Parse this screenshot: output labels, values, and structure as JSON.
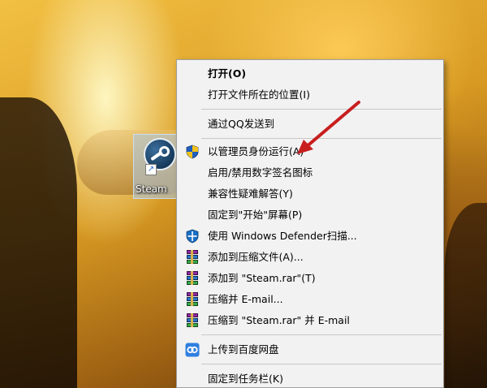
{
  "desktop": {
    "icon_label": "Steam"
  },
  "context_menu": {
    "items": [
      {
        "label": "打开(O)",
        "bold": true
      },
      {
        "label": "打开文件所在的位置(I)"
      },
      {
        "label": "通过QQ发送到"
      },
      {
        "label": "以管理员身份运行(A)",
        "icon": "uac-shield-icon"
      },
      {
        "label": "启用/禁用数字签名图标"
      },
      {
        "label": "兼容性疑难解答(Y)"
      },
      {
        "label": "固定到\"开始\"屏幕(P)"
      },
      {
        "label": "使用 Windows Defender扫描...",
        "icon": "windows-defender-icon"
      },
      {
        "label": "添加到压缩文件(A)...",
        "icon": "winrar-icon"
      },
      {
        "label": "添加到 \"Steam.rar\"(T)",
        "icon": "winrar-icon"
      },
      {
        "label": "压缩并 E-mail...",
        "icon": "winrar-icon"
      },
      {
        "label": "压缩到 \"Steam.rar\" 并 E-mail",
        "icon": "winrar-icon"
      },
      {
        "label": "上传到百度网盘",
        "icon": "baidu-netdisk-icon"
      },
      {
        "label": "固定到任务栏(K)"
      }
    ]
  },
  "colors": {
    "menu_bg": "#f2f2f2",
    "separator": "#c8c8c8",
    "annotation_arrow": "#c81e1e",
    "uac_blue": "#1f5fbf",
    "uac_yellow": "#f2c21b",
    "defender_blue": "#1a6fc4",
    "baidu_blue": "#2f7fe0"
  }
}
